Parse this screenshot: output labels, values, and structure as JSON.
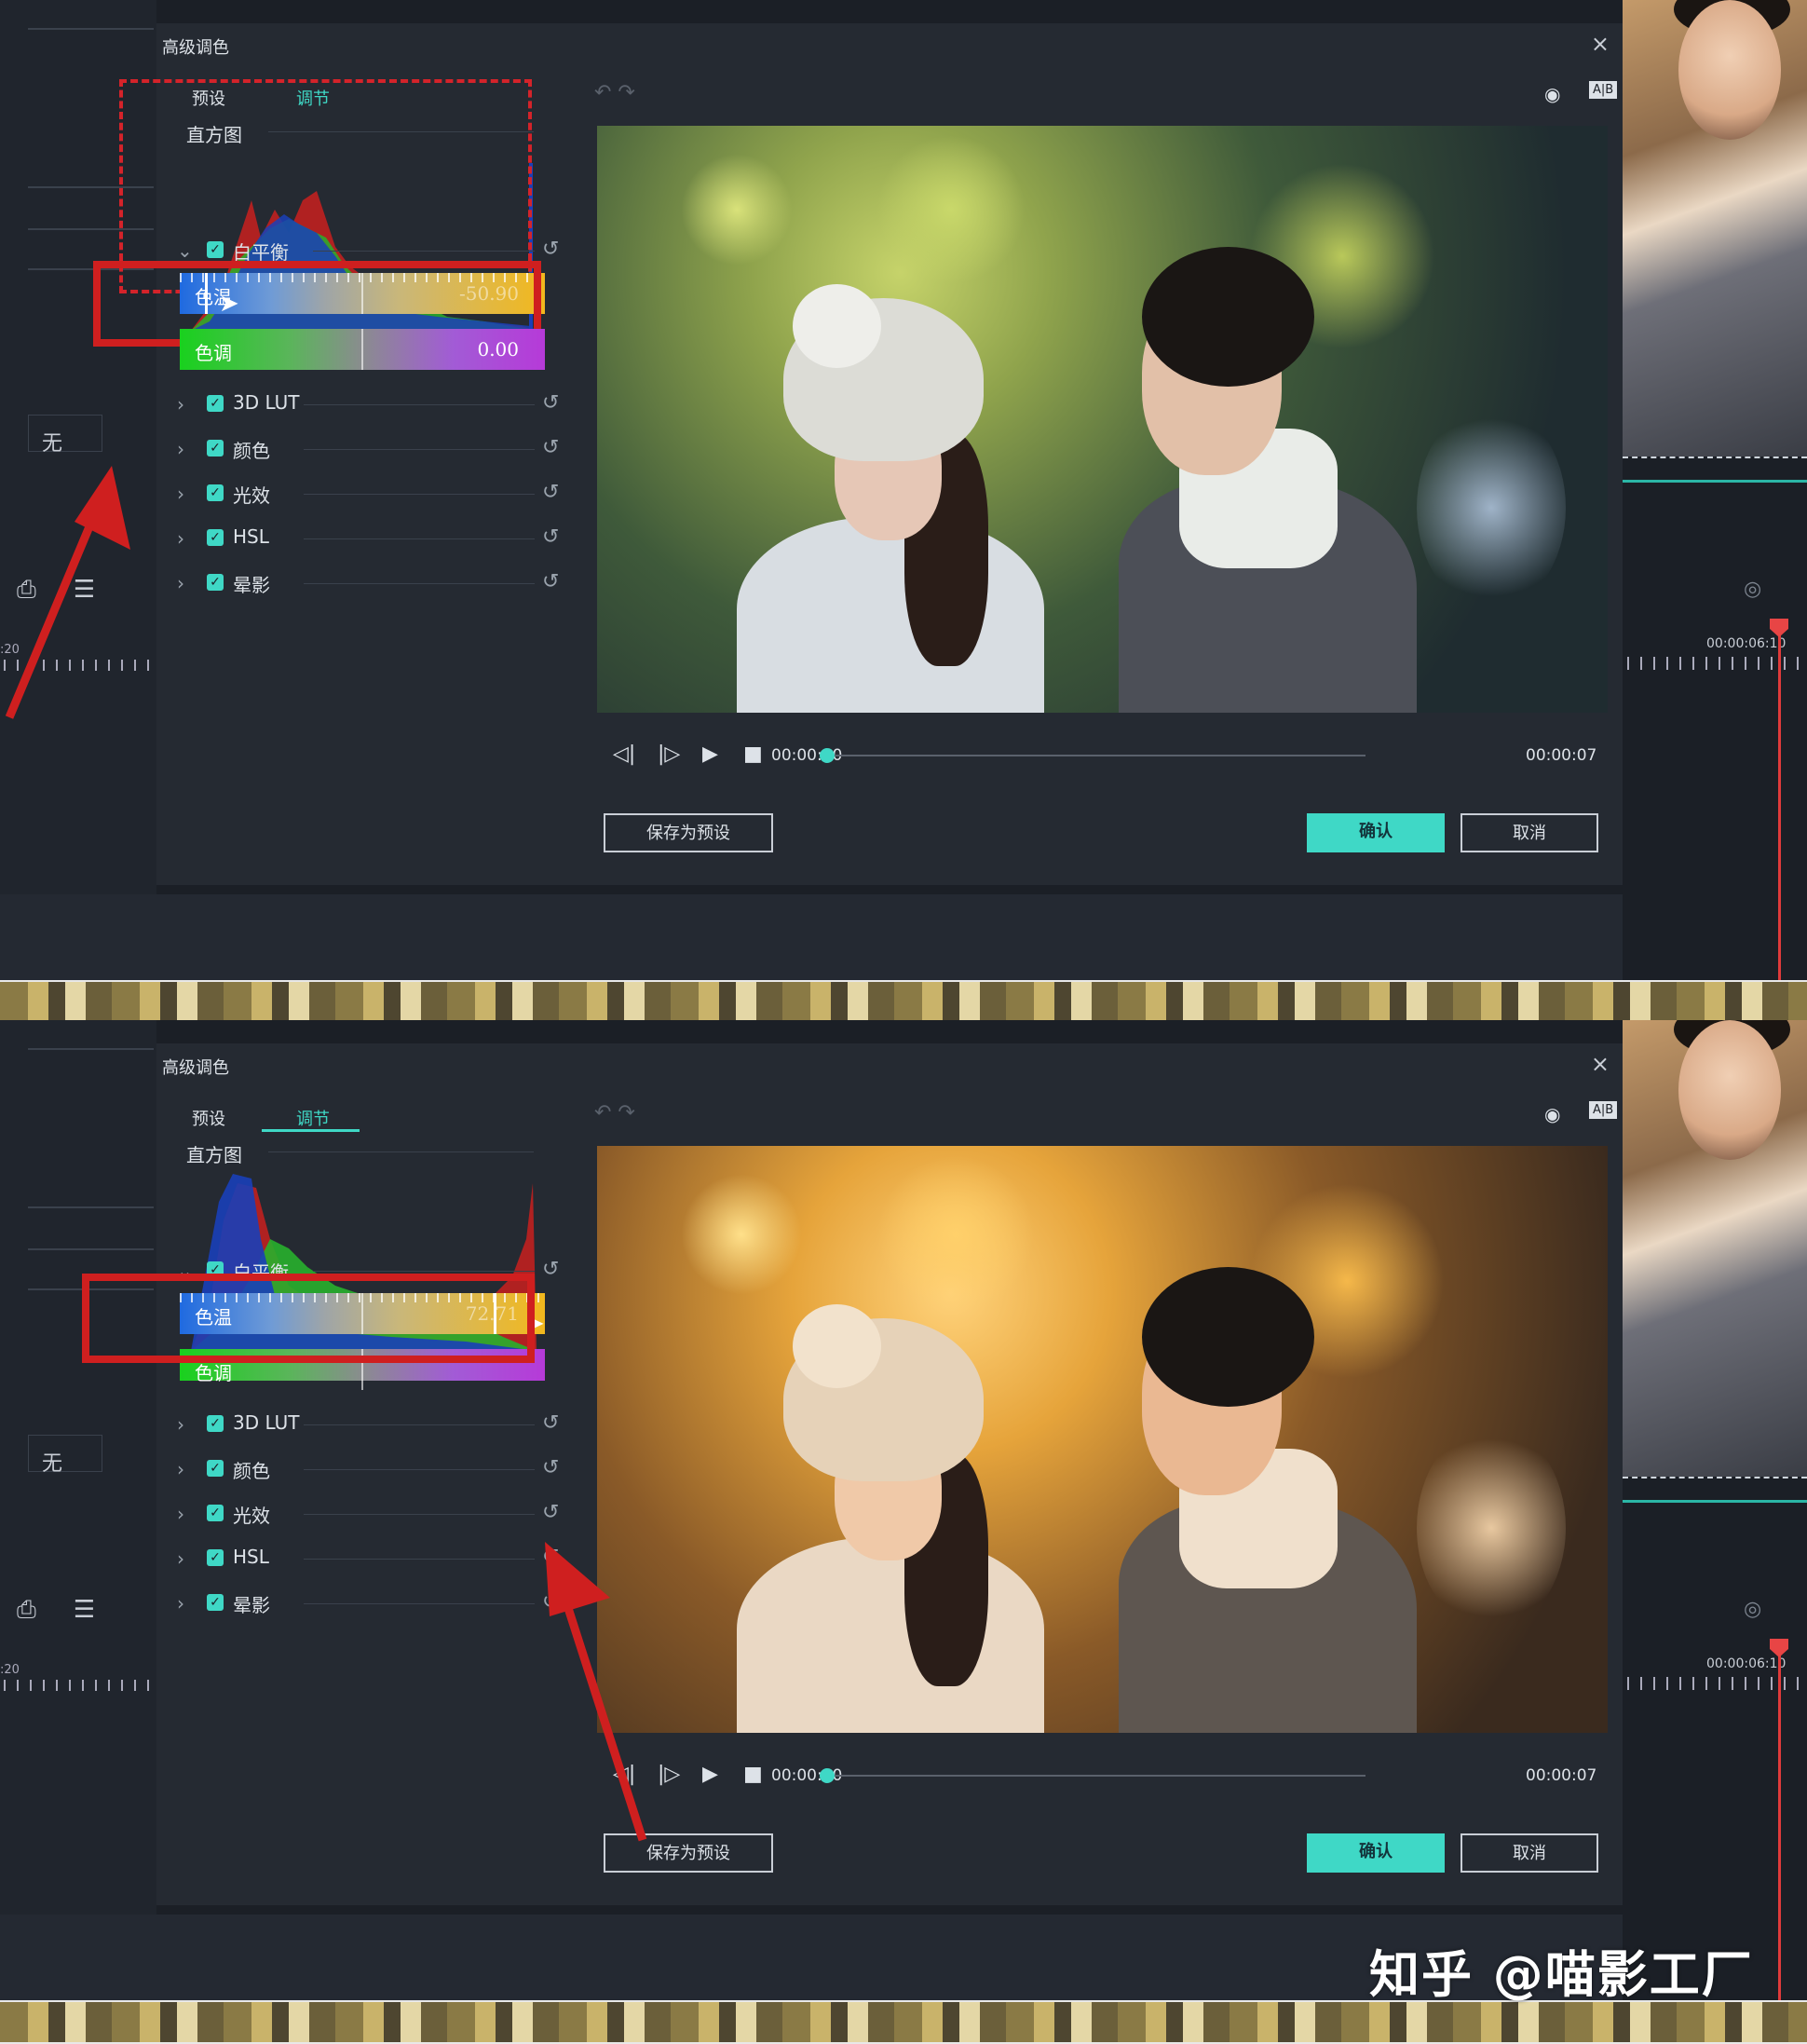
{
  "background": {
    "none_label": "无",
    "ruler_left": ":20",
    "ruler_right": "00:00:06:10"
  },
  "dialog": {
    "title": "高级调色",
    "tabs": [
      "预设",
      "调节"
    ],
    "histogram_label": "直方图",
    "sections": {
      "white_balance": "白平衡",
      "lut": "3D LUT",
      "color": "颜色",
      "light": "光效",
      "hsl": "HSL",
      "vignette": "晕影"
    },
    "player": {
      "current_time": "00:00:00",
      "end_time": "00:00:07"
    },
    "buttons": {
      "save_preset": "保存为预设",
      "ok": "确认",
      "cancel": "取消"
    }
  },
  "panels": [
    {
      "temperature": {
        "label": "色温",
        "value": "-50.90",
        "fraction": 0.07
      },
      "tint": {
        "label": "色调",
        "value": "0.00",
        "fraction": 0.5
      }
    },
    {
      "temperature": {
        "label": "色温",
        "value": "72.71",
        "fraction": 0.86
      },
      "tint": {
        "label": "色调",
        "value": "",
        "fraction": 0.5
      }
    }
  ],
  "colors": {
    "accent": "#3fd8c6",
    "annotation": "#d4232a"
  },
  "watermark": "知乎 @喵影工厂"
}
